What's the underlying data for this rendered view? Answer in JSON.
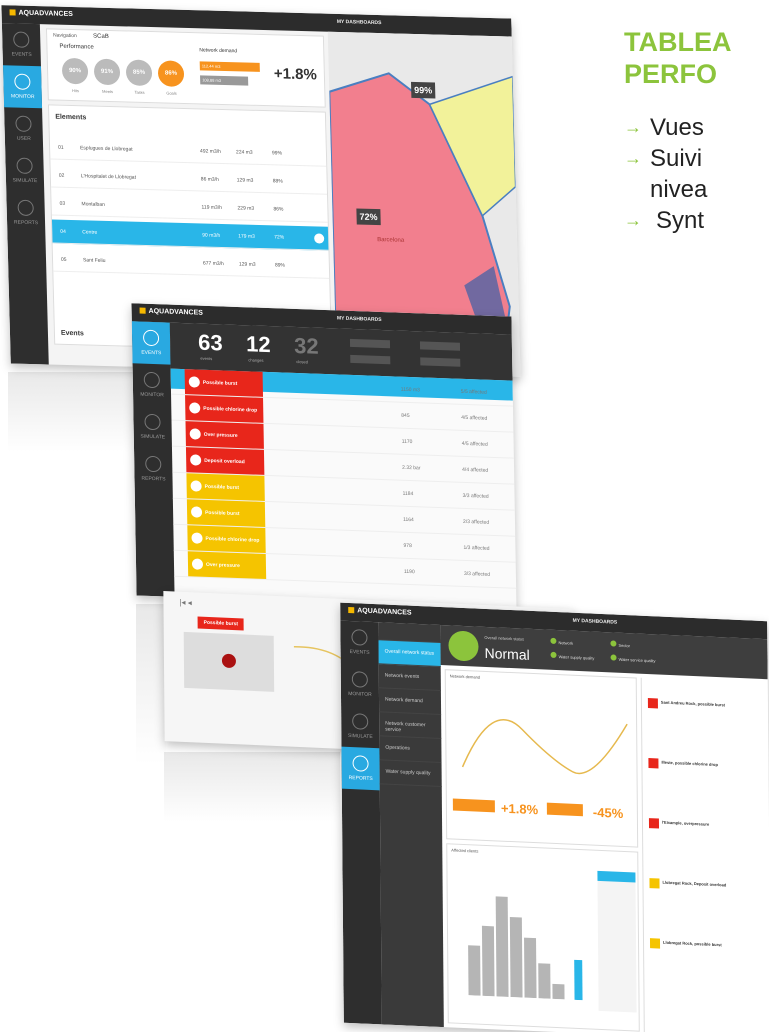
{
  "slide": {
    "title_line1": "TABLEA",
    "title_line2": "PERFO",
    "bullets": [
      "Vues",
      "Suivi",
      "nivea",
      "Synt"
    ],
    "accent": "#8cc43c"
  },
  "app": {
    "brand": "AQUADVANCES",
    "dashboards": "MY DASHBOARDS",
    "nav": [
      "EVENTS",
      "MONITOR",
      "USER",
      "SIMULATE",
      "REPORTS"
    ]
  },
  "monitor": {
    "navigation": "Navigation",
    "scab": "SCaB",
    "performance": "Performance",
    "circles": [
      {
        "value": "90%",
        "label": "Hits"
      },
      {
        "value": "91%",
        "label": "Meets"
      },
      {
        "value": "85%",
        "label": "Tasks"
      },
      {
        "value": "86%",
        "label": "Goals"
      }
    ],
    "network_demand": "Network demand",
    "delta": "+1.8%",
    "orange_value": "112,44 m3",
    "grey_value": "108,88 m3",
    "elements_title": "Elements",
    "elements": [
      {
        "id": "01",
        "name": "Esplugues de Llobregat",
        "flow": "492 m3/h",
        "pressure": "224 m3",
        "pct": "99%"
      },
      {
        "id": "02",
        "name": "L'Hospitalet de Llobregat",
        "flow": "86 m3/h",
        "pressure": "129 m3",
        "pct": "88%"
      },
      {
        "id": "03",
        "name": "Montalban",
        "flow": "119 m3/h",
        "pressure": "229 m3",
        "pct": "86%"
      },
      {
        "id": "04",
        "name": "Centre",
        "flow": "90 m3/h",
        "pressure": "179 m3",
        "pct": "72%"
      },
      {
        "id": "05",
        "name": "Sant Feliu",
        "flow": "677 m3/h",
        "pressure": "129 m3",
        "pct": "89%"
      }
    ],
    "events_footer": "Events",
    "map_badges": [
      "99%",
      "72%"
    ],
    "map_label": "Barcelona"
  },
  "events": {
    "counters": [
      {
        "value": "63",
        "label": "events"
      },
      {
        "value": "12",
        "label": "changes"
      },
      {
        "value": "32",
        "label": "closed"
      }
    ],
    "rows": [
      {
        "label": "Possible burst",
        "color": "#e8261b",
        "flow": "1150 m3",
        "affected": "5/5 affected"
      },
      {
        "label": "Possible chlorine drop",
        "color": "#e8261b",
        "flow": "845",
        "affected": "4/5 affected"
      },
      {
        "label": "Over pressure",
        "color": "#e8261b",
        "flow": "1170",
        "affected": "4/5 affected"
      },
      {
        "label": "Deposit overload",
        "color": "#e8261b",
        "flow": "2.32 bar",
        "affected": "4/4 affected"
      },
      {
        "label": "Possible burst",
        "color": "#f5c400",
        "flow": "1184",
        "affected": "3/3 affected"
      },
      {
        "label": "Possible burst",
        "color": "#f5c400",
        "flow": "1164",
        "affected": "2/3 affected"
      },
      {
        "label": "Possible chlorine drop",
        "color": "#f5c400",
        "flow": "978",
        "affected": "1/3 affected"
      },
      {
        "label": "Over pressure",
        "color": "#f5c400",
        "flow": "1190",
        "affected": "3/3 affected"
      }
    ],
    "detail_tag": "Possible burst"
  },
  "overview": {
    "menu": [
      "Overall network status",
      "Network events",
      "Network demand",
      "Network customer service",
      "Operations",
      "Water supply quality"
    ],
    "status_label": "Overall network status",
    "status": "Normal",
    "legend_items": [
      "Network",
      "Water supply quality",
      "Sector",
      "Water service quality"
    ],
    "chart_title": "Network demand",
    "delta1": "+1.8%",
    "delta2": "-45%",
    "affected_title": "Affected clients",
    "alerts": [
      {
        "title": "Sant Andreu Rock, possible burst",
        "color": "#e8261b"
      },
      {
        "title": "Illeste, possible chlorine drop",
        "color": "#e8261b"
      },
      {
        "title": "l'Eixample, overpressure",
        "color": "#e8261b"
      },
      {
        "title": "Llobregat Rock, Deposit overload",
        "color": "#f5c400"
      },
      {
        "title": "Llobregat Rock, possible burst",
        "color": "#f5c400"
      }
    ]
  }
}
